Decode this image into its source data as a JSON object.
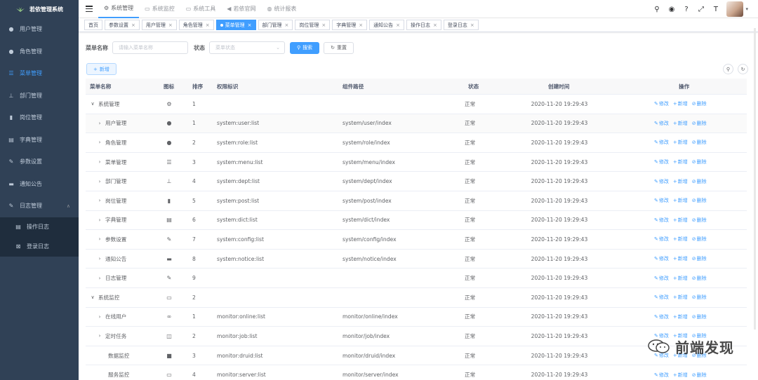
{
  "app": {
    "title": "若依管理系统"
  },
  "sidebar": {
    "items": [
      {
        "label": "用户管理",
        "icon": "user-icon",
        "glyph": "●"
      },
      {
        "label": "角色管理",
        "icon": "peoples-icon",
        "glyph": "●"
      },
      {
        "label": "菜单管理",
        "icon": "tree-table-icon",
        "glyph": "☰"
      },
      {
        "label": "部门管理",
        "icon": "tree-icon",
        "glyph": "⊥"
      },
      {
        "label": "岗位管理",
        "icon": "post-icon",
        "glyph": "▮"
      },
      {
        "label": "字典管理",
        "icon": "dict-icon",
        "glyph": "▤"
      },
      {
        "label": "参数设置",
        "icon": "edit-icon",
        "glyph": "✎"
      },
      {
        "label": "通知公告",
        "icon": "message-icon",
        "glyph": "▬"
      },
      {
        "label": "日志管理",
        "icon": "log-icon",
        "glyph": "✎"
      }
    ],
    "sub_items": [
      {
        "label": "操作日志",
        "icon": "form-icon",
        "glyph": "▤"
      },
      {
        "label": "登录日志",
        "icon": "logininfor-icon",
        "glyph": "⊠"
      }
    ]
  },
  "navbar": {
    "items": [
      {
        "label": "系统管理",
        "glyph": "⚙"
      },
      {
        "label": "系统监控",
        "glyph": "▭"
      },
      {
        "label": "系统工具",
        "glyph": "▭"
      },
      {
        "label": "若依官网",
        "glyph": "◀"
      },
      {
        "label": "统计报表",
        "glyph": "◍"
      }
    ],
    "tools": [
      {
        "name": "search-icon",
        "glyph": "⚲"
      },
      {
        "name": "github-icon",
        "glyph": "◉"
      },
      {
        "name": "question-icon",
        "glyph": "?"
      },
      {
        "name": "fullscreen-icon",
        "glyph": "⤢"
      },
      {
        "name": "size-icon",
        "glyph": "T"
      }
    ]
  },
  "tags": [
    {
      "label": "首页",
      "closable": false
    },
    {
      "label": "参数设置",
      "closable": true
    },
    {
      "label": "用户管理",
      "closable": true
    },
    {
      "label": "角色管理",
      "closable": true
    },
    {
      "label": "菜单管理",
      "closable": true,
      "active": true
    },
    {
      "label": "部门管理",
      "closable": true
    },
    {
      "label": "岗位管理",
      "closable": true
    },
    {
      "label": "字典管理",
      "closable": true
    },
    {
      "label": "通知公告",
      "closable": true
    },
    {
      "label": "操作日志",
      "closable": true
    },
    {
      "label": "登录日志",
      "closable": true
    }
  ],
  "search": {
    "name_label": "菜单名称",
    "name_placeholder": "请输入菜单名称",
    "status_label": "状态",
    "status_placeholder": "菜单状态",
    "search_btn": "搜索",
    "reset_btn": "重置"
  },
  "toolbar": {
    "add_btn": "新增"
  },
  "table": {
    "columns": {
      "name": "菜单名称",
      "icon": "图标",
      "order": "排序",
      "perms": "权限标识",
      "component": "组件路径",
      "status": "状态",
      "created": "创建时间",
      "ops": "操作"
    },
    "ops": {
      "edit": "修改",
      "add": "新增",
      "del": "删除"
    },
    "rows": [
      {
        "name": "系统管理",
        "level": 0,
        "expander": "∨",
        "icon": "⚙",
        "order": "1",
        "perms": "",
        "component": "",
        "status": "正常",
        "created": "2020-11-20 19:29:43"
      },
      {
        "name": "用户管理",
        "level": 1,
        "expander": "›",
        "icon": "●",
        "order": "1",
        "perms": "system:user:list",
        "component": "system/user/index",
        "status": "正常",
        "created": "2020-11-20 19:29:43"
      },
      {
        "name": "角色管理",
        "level": 1,
        "expander": "›",
        "icon": "●",
        "order": "2",
        "perms": "system:role:list",
        "component": "system/role/index",
        "status": "正常",
        "created": "2020-11-20 19:29:43"
      },
      {
        "name": "菜单管理",
        "level": 1,
        "expander": "›",
        "icon": "☰",
        "order": "3",
        "perms": "system:menu:list",
        "component": "system/menu/index",
        "status": "正常",
        "created": "2020-11-20 19:29:43"
      },
      {
        "name": "部门管理",
        "level": 1,
        "expander": "›",
        "icon": "⊥",
        "order": "4",
        "perms": "system:dept:list",
        "component": "system/dept/index",
        "status": "正常",
        "created": "2020-11-20 19:29:43"
      },
      {
        "name": "岗位管理",
        "level": 1,
        "expander": "›",
        "icon": "▮",
        "order": "5",
        "perms": "system:post:list",
        "component": "system/post/index",
        "status": "正常",
        "created": "2020-11-20 19:29:43"
      },
      {
        "name": "字典管理",
        "level": 1,
        "expander": "›",
        "icon": "▤",
        "order": "6",
        "perms": "system:dict:list",
        "component": "system/dict/index",
        "status": "正常",
        "created": "2020-11-20 19:29:43"
      },
      {
        "name": "参数设置",
        "level": 1,
        "expander": "›",
        "icon": "✎",
        "order": "7",
        "perms": "system:config:list",
        "component": "system/config/index",
        "status": "正常",
        "created": "2020-11-20 19:29:43"
      },
      {
        "name": "通知公告",
        "level": 1,
        "expander": "›",
        "icon": "▬",
        "order": "8",
        "perms": "system:notice:list",
        "component": "system/notice/index",
        "status": "正常",
        "created": "2020-11-20 19:29:43"
      },
      {
        "name": "日志管理",
        "level": 1,
        "expander": "›",
        "icon": "✎",
        "order": "9",
        "perms": "",
        "component": "",
        "status": "正常",
        "created": "2020-11-20 19:29:43"
      },
      {
        "name": "系统监控",
        "level": 0,
        "expander": "∨",
        "icon": "▭",
        "order": "2",
        "perms": "",
        "component": "",
        "status": "正常",
        "created": "2020-11-20 19:29:43"
      },
      {
        "name": "在线用户",
        "level": 1,
        "expander": "›",
        "icon": "∞",
        "order": "1",
        "perms": "monitor:online:list",
        "component": "monitor/online/index",
        "status": "正常",
        "created": "2020-11-20 19:29:43"
      },
      {
        "name": "定时任务",
        "level": 1,
        "expander": "›",
        "icon": "◫",
        "order": "2",
        "perms": "monitor:job:list",
        "component": "monitor/job/index",
        "status": "正常",
        "created": "2020-11-20 19:29:43"
      },
      {
        "name": "数据监控",
        "level": 1,
        "expander": "",
        "icon": "■",
        "order": "3",
        "perms": "monitor:druid:list",
        "component": "monitor/druid/index",
        "status": "正常",
        "created": "2020-11-20 19:29:43"
      },
      {
        "name": "服务监控",
        "level": 1,
        "expander": "",
        "icon": "▭",
        "order": "4",
        "perms": "monitor:server:list",
        "component": "monitor/server/index",
        "status": "正常",
        "created": "2020-11-20 19:29:43"
      }
    ]
  },
  "watermark": {
    "text": "前端发现"
  },
  "colors": {
    "sidebar_bg": "#304156",
    "primary": "#409eff",
    "active_menu": "#409eff"
  }
}
